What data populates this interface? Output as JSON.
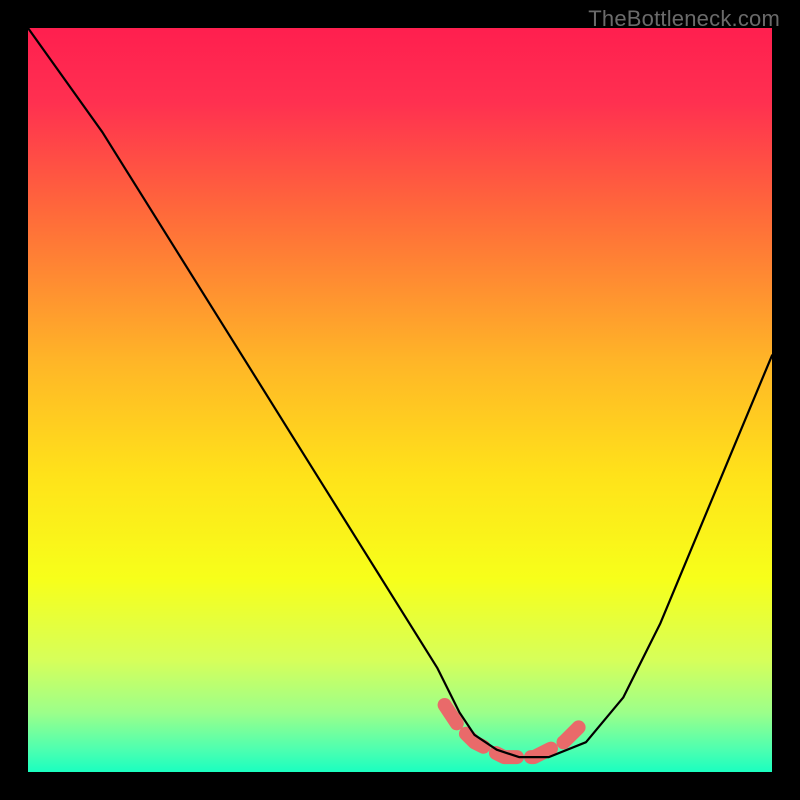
{
  "watermark": "TheBottleneck.com",
  "chart_data": {
    "type": "line",
    "title": "",
    "xlabel": "",
    "ylabel": "",
    "xlim": [
      0,
      100
    ],
    "ylim": [
      0,
      100
    ],
    "grid": false,
    "legend": false,
    "series": [
      {
        "name": "bottleneck-curve",
        "x": [
          0,
          5,
          10,
          15,
          20,
          25,
          30,
          35,
          40,
          45,
          50,
          55,
          58,
          60,
          63,
          66,
          70,
          75,
          80,
          85,
          90,
          95,
          100
        ],
        "y": [
          100,
          93,
          86,
          78,
          70,
          62,
          54,
          46,
          38,
          30,
          22,
          14,
          8,
          5,
          3,
          2,
          2,
          4,
          10,
          20,
          32,
          44,
          56
        ]
      },
      {
        "name": "sweet-spot-marker",
        "x": [
          56,
          58,
          60,
          62,
          64,
          66,
          68,
          70,
          72,
          74
        ],
        "y": [
          9,
          6,
          4,
          3,
          2,
          2,
          2,
          3,
          4,
          6
        ]
      }
    ],
    "gradient_stops": [
      {
        "offset": 0.0,
        "color": "#ff1f4f"
      },
      {
        "offset": 0.1,
        "color": "#ff3050"
      },
      {
        "offset": 0.25,
        "color": "#ff6a3a"
      },
      {
        "offset": 0.45,
        "color": "#ffb627"
      },
      {
        "offset": 0.6,
        "color": "#ffe21a"
      },
      {
        "offset": 0.74,
        "color": "#f7ff1a"
      },
      {
        "offset": 0.85,
        "color": "#d6ff5a"
      },
      {
        "offset": 0.92,
        "color": "#9cff8a"
      },
      {
        "offset": 0.97,
        "color": "#4dffb0"
      },
      {
        "offset": 1.0,
        "color": "#1affc0"
      }
    ],
    "colors": {
      "curve": "#000000",
      "sweet_spot": "#e96a6a",
      "background": "#000000"
    }
  }
}
